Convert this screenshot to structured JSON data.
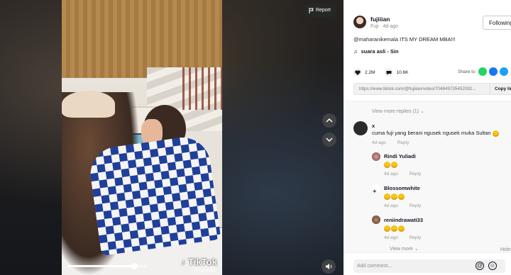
{
  "video": {
    "report_label": "Report",
    "progress": 0.84,
    "watermark_brand": "TikTok",
    "watermark_user": "@fujiiian"
  },
  "author": {
    "username": "fujiiian",
    "display_name": "Fuji",
    "time_ago": "4d ago",
    "follow_label": "Following"
  },
  "caption": {
    "mention": "@maharanikemala",
    "text": " ITS MY DREAM MBA!!!"
  },
  "music": {
    "title": "suara asli - Sin"
  },
  "stats": {
    "likes": "2.2M",
    "comments": "10.6K",
    "share_label": "Share to"
  },
  "share_colors": [
    "#25d366",
    "#1877f2",
    "#1da1f2"
  ],
  "link": {
    "url": "https://www.tiktok.com/@fujiiian/video/704849735452092...",
    "copy_label": "Copy link"
  },
  "comments": {
    "view_more_top": "View more replies (1)",
    "items": [
      {
        "name": "x",
        "text": "cuma fuji yang berani ngusek ngusek muka Sultan",
        "emoji_count": 1,
        "date": "4d ago",
        "reply": "Reply",
        "reply_level": 0
      },
      {
        "name": "Rindi Yuliadi",
        "text": "",
        "emoji_count": 2,
        "date": "4d ago",
        "reply": "Reply",
        "reply_level": 1
      },
      {
        "name": "Blossomwhite",
        "text": "",
        "emoji_count": 3,
        "date": "4d ago",
        "reply": "Reply",
        "reply_level": 1
      },
      {
        "name": "reniindrawati33",
        "text": "",
        "emoji_count": 3,
        "date": "4d ago",
        "reply": "Reply",
        "reply_level": 1
      }
    ],
    "view_more_bottom": "View more",
    "hide_label": "Hide"
  },
  "add_comment": {
    "placeholder": "Add comment..."
  }
}
